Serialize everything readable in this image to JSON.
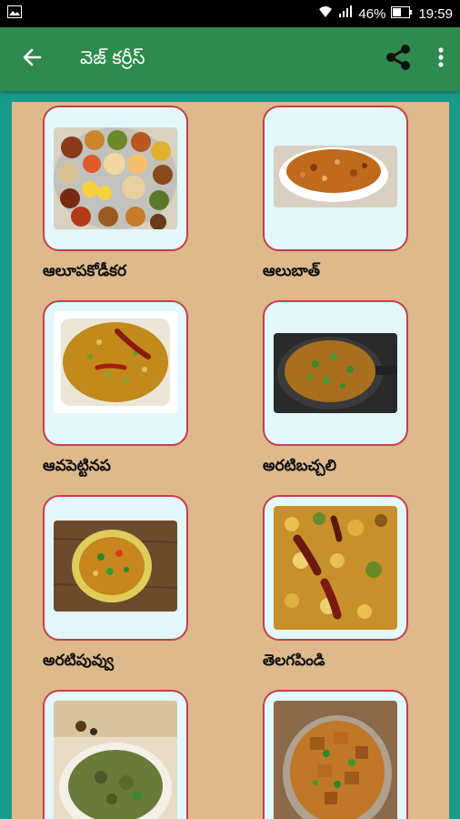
{
  "status_bar": {
    "battery": "46%",
    "time": "19:59",
    "gallery_icon": "image-notification-icon",
    "colors": {
      "bg": "#000000",
      "text": "#ffffff"
    }
  },
  "app_bar": {
    "title": "వెజ్ కర్రీస్",
    "back_icon": "arrow-left-icon",
    "share_icon": "share-icon",
    "more_icon": "more-vert-icon",
    "colors": {
      "bg": "#2e8a4e",
      "text": "#ffffff"
    }
  },
  "theme": {
    "page_bg": "#1a9a8a",
    "content_bg": "#ddb98c",
    "card_bg": "#e3f7fc",
    "card_border": "#c4404a"
  },
  "items": [
    {
      "label": "ఆలూపకోడీకర"
    },
    {
      "label": "ఆలుబాత్"
    },
    {
      "label": "ఆవపెట్టినప"
    },
    {
      "label": "అరటిబచ్చలి"
    },
    {
      "label": "అరటిపువ్వు"
    },
    {
      "label": "తెలగపిండి"
    },
    {
      "label": ""
    },
    {
      "label": ""
    }
  ]
}
